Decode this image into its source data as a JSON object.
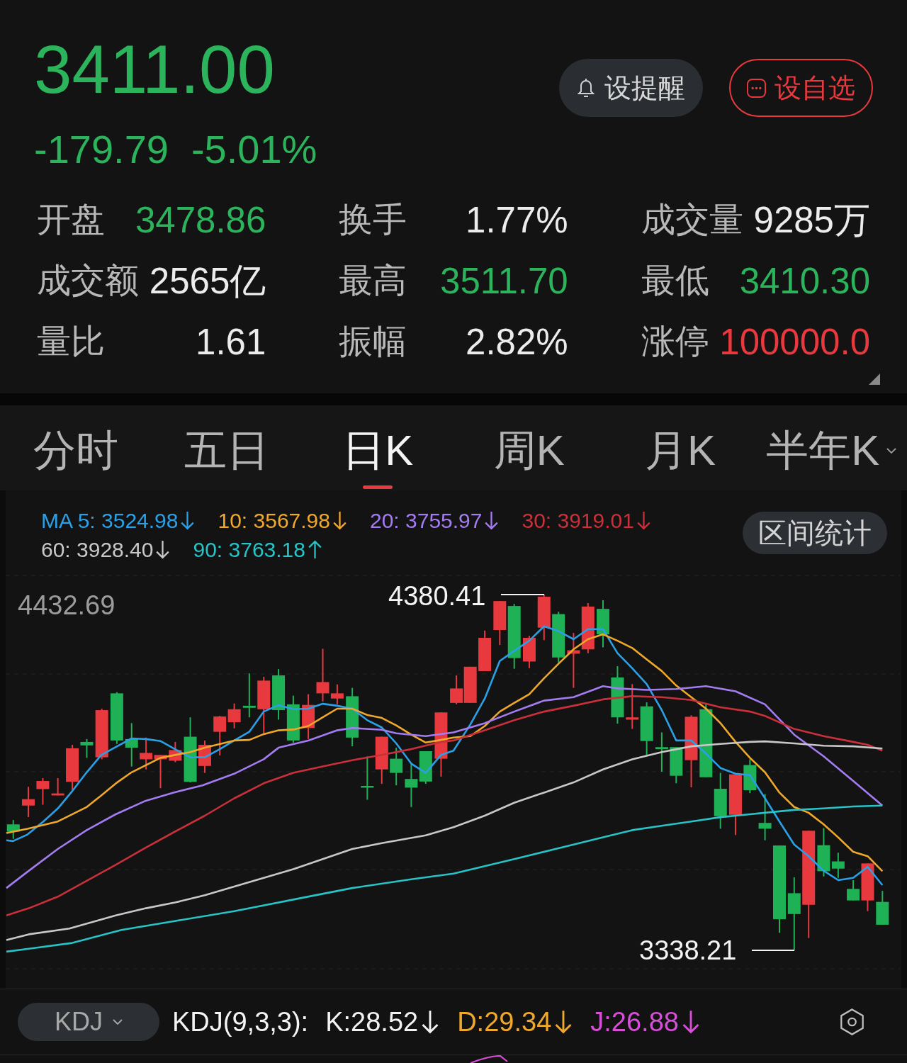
{
  "quote": {
    "price": "3411.00",
    "change": "-179.79",
    "change_percent": "-5.01%",
    "rising": false
  },
  "actions": [
    {
      "label": "设提醒",
      "kind": "alert"
    },
    {
      "label": "设自选",
      "kind": "watchlist"
    }
  ],
  "stats": [
    {
      "label": "开盘",
      "value": "3478.86",
      "color": "#2cb45c"
    },
    {
      "label": "换手",
      "value": "1.77%",
      "color": "#ececec"
    },
    {
      "label": "成交量",
      "value": "9285万",
      "color": "#ececec"
    },
    {
      "label": "成交额",
      "value": "2565亿",
      "color": "#ececec"
    },
    {
      "label": "最高",
      "value": "3511.70",
      "color": "#2cb45c"
    },
    {
      "label": "最低",
      "value": "3410.30",
      "color": "#2cb45c"
    },
    {
      "label": "量比",
      "value": "1.61",
      "color": "#ececec"
    },
    {
      "label": "振幅",
      "value": "2.82%",
      "color": "#ececec"
    },
    {
      "label": "涨停",
      "value": "100000.0",
      "color": "#e8393f"
    }
  ],
  "tabs": [
    {
      "label": "分时",
      "selected": false,
      "dropdown": false
    },
    {
      "label": "五日",
      "selected": false,
      "dropdown": false
    },
    {
      "label": "日K",
      "selected": true,
      "dropdown": false
    },
    {
      "label": "周K",
      "selected": false,
      "dropdown": false
    },
    {
      "label": "月K",
      "selected": false,
      "dropdown": false
    },
    {
      "label": "半年K",
      "selected": false,
      "dropdown": true
    }
  ],
  "ma_legend": [
    {
      "text": "MA 5: 3524.98",
      "rising": false,
      "color": "#2aa0e6"
    },
    {
      "text": "10: 3567.98",
      "rising": false,
      "color": "#f0a82b"
    },
    {
      "text": "20: 3755.97",
      "rising": false,
      "color": "#a47cf2"
    },
    {
      "text": "30: 3919.01",
      "rising": false,
      "color": "#c9303a"
    },
    {
      "text": "60: 3928.40",
      "rising": false,
      "color": "#c8c8c8"
    },
    {
      "text": "90: 3763.18",
      "rising": true,
      "color": "#27c3c6"
    }
  ],
  "range_stats_button": "区间统计",
  "chart": {
    "axis_max": "4432.69",
    "high_marker": "4380.41",
    "low_marker": "3338.21"
  },
  "indicator": {
    "selector": "KDJ",
    "title": "KDJ(9,3,3):",
    "values": [
      {
        "text": "K:28.52",
        "rising": false,
        "color": "#f2f2f2"
      },
      {
        "text": "D:29.34",
        "rising": false,
        "color": "#f0a82b"
      },
      {
        "text": "J:26.88",
        "rising": false,
        "color": "#d64fd6"
      }
    ]
  }
}
